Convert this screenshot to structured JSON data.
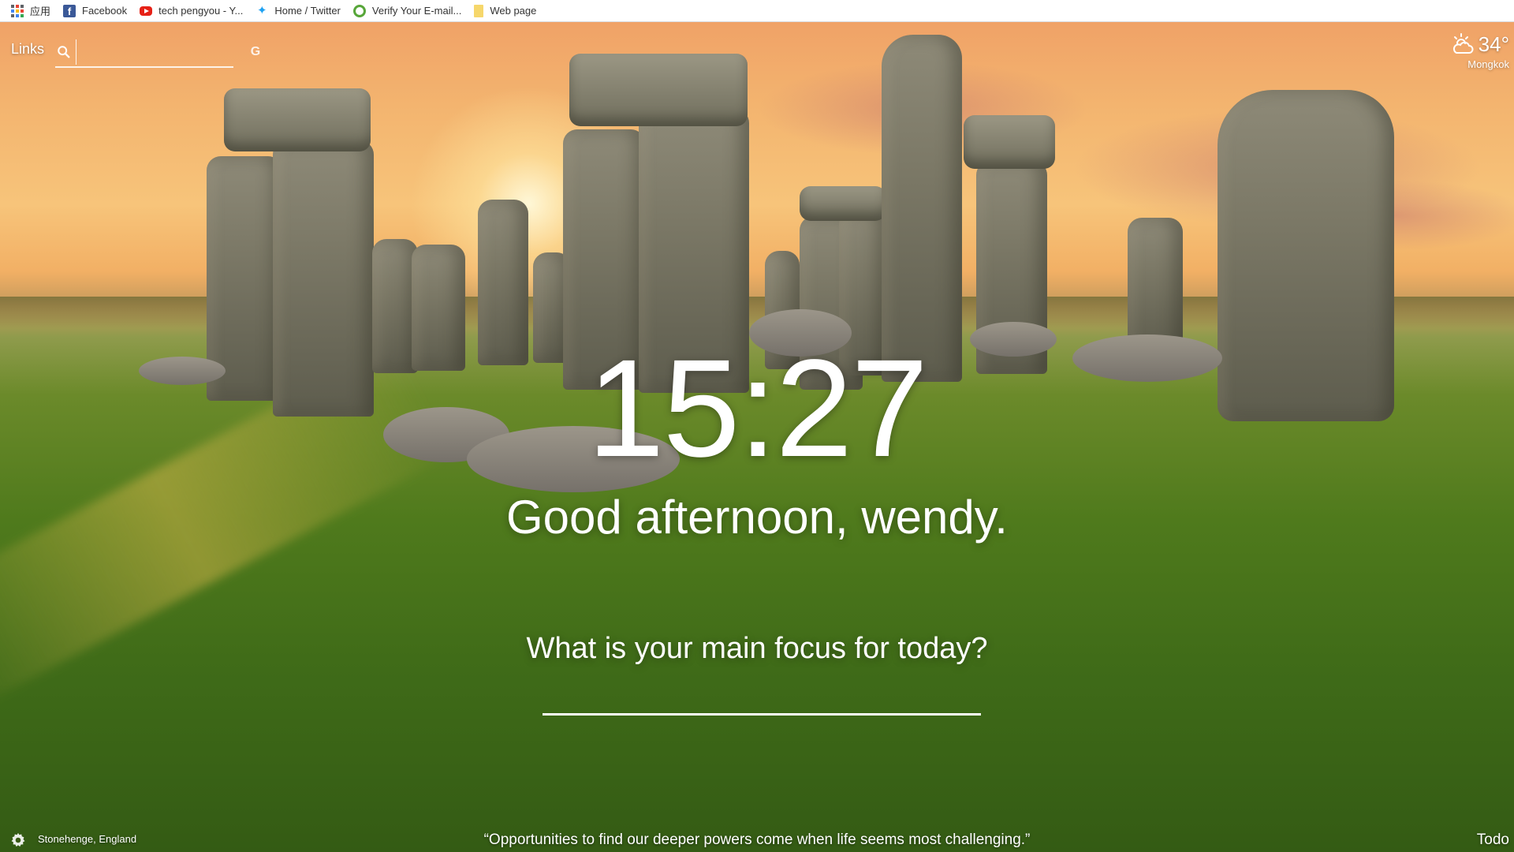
{
  "bookmarks": [
    {
      "label": "应用",
      "icon": "apps-grid-icon"
    },
    {
      "label": "Facebook",
      "icon": "facebook-icon"
    },
    {
      "label": "tech pengyou - Y...",
      "icon": "youtube-icon"
    },
    {
      "label": "Home / Twitter",
      "icon": "twitter-icon"
    },
    {
      "label": "Verify Your E-mail...",
      "icon": "verify-icon"
    },
    {
      "label": "Web page",
      "icon": "web-page-icon"
    }
  ],
  "links": {
    "label": "Links"
  },
  "search": {
    "value": "",
    "placeholder": ""
  },
  "weather": {
    "temperature": "34°",
    "location": "Mongkok",
    "icon": "partly-cloudy-icon"
  },
  "clock": {
    "time": "15:27"
  },
  "greeting": {
    "text": "Good afternoon, wendy."
  },
  "focus": {
    "question": "What is your main focus for today?",
    "value": ""
  },
  "footer": {
    "photo_location": "Stonehenge, England",
    "quote": "“Opportunities to find our deeper powers come when life seems most challenging.”",
    "todo_label": "Todo"
  },
  "colors": {
    "text": "#ffffff",
    "bookmark_bar": "#ffffff"
  }
}
